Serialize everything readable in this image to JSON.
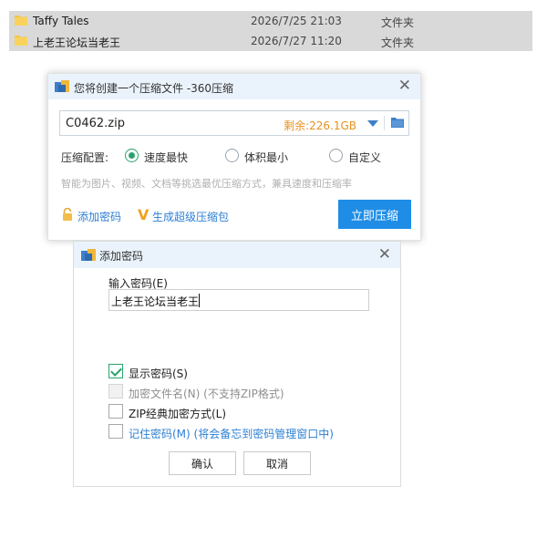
{
  "files": [
    {
      "name": "Taffy Tales",
      "date": "2026/7/25 21:03",
      "type": "文件夹"
    },
    {
      "name": "上老王论坛当老王",
      "date": "2026/7/27 11:20",
      "type": "文件夹"
    }
  ],
  "zip_dialog": {
    "title": "您将创建一个压缩文件 -360压缩",
    "close": "✕",
    "filename": "C0462.zip",
    "remaining": "剩余:226.1GB",
    "config_label": "压缩配置:",
    "options": [
      "速度最快",
      "体积最小",
      "自定义"
    ],
    "selected_option": "速度最快",
    "hint": "智能为图片、视频、文档等挑选最优压缩方式，兼具速度和压缩率",
    "add_password": "添加密码",
    "super_package": "生成超级压缩包",
    "compress_button": "立即压缩"
  },
  "pwd_dialog": {
    "title": "添加密码",
    "close": "✕",
    "input_label": "输入密码(E)",
    "password_value": "上老王论坛当老王",
    "options": {
      "show_password": "显示密码(S)",
      "encrypt_filename": "加密文件名(N) (不支持ZIP格式)",
      "zip_classic": "ZIP经典加密方式(L)",
      "remember": "记住密码(M) (将会备忘到密码管理窗口中)"
    },
    "ok_button": "确认",
    "cancel_button": "取消"
  },
  "colors": {
    "accent_blue": "#1f8de6",
    "link_blue": "#2d7fd3",
    "remaining_orange": "#e8911f",
    "check_green": "#2aa36b",
    "title_bar": "#eaf3fb",
    "selected_row": "#d9d9d9"
  },
  "icons": [
    "folder-icon",
    "360zip-app-icon",
    "close-icon",
    "dropdown-arrow-icon",
    "browse-folder-icon",
    "lock-icon",
    "v-super-icon",
    "checkmark-icon"
  ]
}
